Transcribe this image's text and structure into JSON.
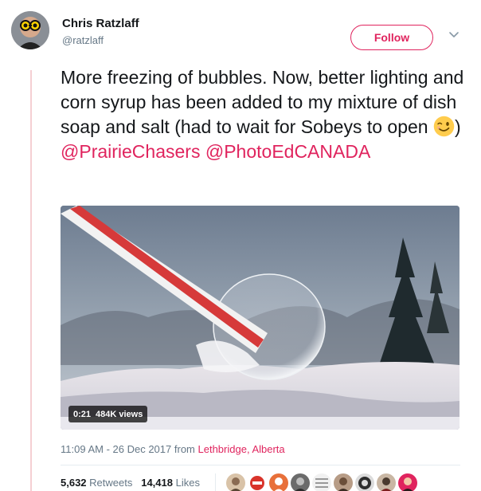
{
  "author": {
    "name": "Chris Ratzlaff",
    "handle": "@ratzlaff"
  },
  "follow_label": "Follow",
  "tweet": {
    "text_before": "More freezing of bubbles. Now, better lighting and corn syrup has been added to my mixture of dish soap and salt (had to wait for Sobeys to open ",
    "emoji": "winking-face",
    "text_after": ")",
    "mention_1": "@PrairieChasers",
    "mention_2": "@PhotoEdCANADA"
  },
  "video": {
    "duration": "0:21",
    "views": "484K views"
  },
  "meta": {
    "timestamp": "11:09 AM - 26 Dec 2017",
    "from_label": "from",
    "location": "Lethbridge, Alberta"
  },
  "stats": {
    "retweets_count": "5,632",
    "retweets_label": "Retweets",
    "likes_count": "14,418",
    "likes_label": "Likes"
  },
  "colors": {
    "accent": "#e0245e",
    "text": "#14171a",
    "secondary": "#657786"
  }
}
